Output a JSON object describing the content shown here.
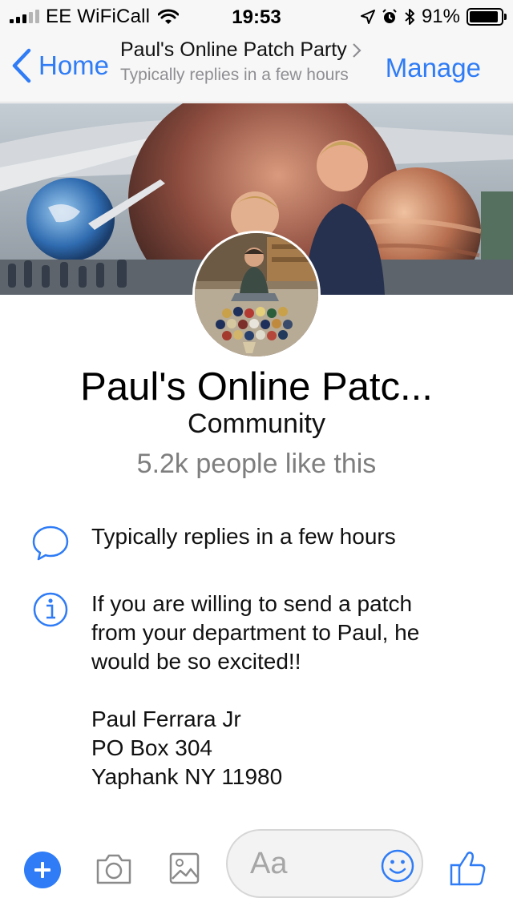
{
  "status_bar": {
    "carrier": "EE WiFiCall",
    "time": "19:53",
    "battery_percent": "91%",
    "battery_level": 0.91
  },
  "nav": {
    "back_label": "Home",
    "title": "Paul's Online Patch Party",
    "subtitle": "Typically replies in a few hours",
    "manage_label": "Manage"
  },
  "page": {
    "name": "Paul's Online Patc...",
    "category": "Community",
    "likes": "5.2k people like this"
  },
  "info": {
    "replies_text": "Typically replies in a few hours",
    "about_lines": [
      "If you are willing to send a patch",
      "from your department to Paul, he",
      "would be so excited!!",
      "",
      "Paul Ferrara Jr",
      "PO Box 304",
      "Yaphank NY 11980"
    ]
  },
  "composer": {
    "placeholder": "Aa"
  },
  "icons": {
    "signal": "signal-bars-icon",
    "wifi": "wifi-icon",
    "location": "location-arrow-icon",
    "alarm": "alarm-icon",
    "bluetooth": "bluetooth-icon",
    "battery": "battery-icon",
    "back": "chevron-left-icon",
    "title_chevron": "chevron-right-icon",
    "replies": "chat-bubble-icon",
    "about": "info-icon",
    "plus": "plus-icon",
    "camera": "camera-icon",
    "gallery": "image-icon",
    "emoji": "smiley-icon",
    "like": "thumbs-up-icon"
  },
  "colors": {
    "accent": "#2f7cf6",
    "secondary_text": "#8e8e93",
    "bar_background": "#f7f7f7"
  }
}
